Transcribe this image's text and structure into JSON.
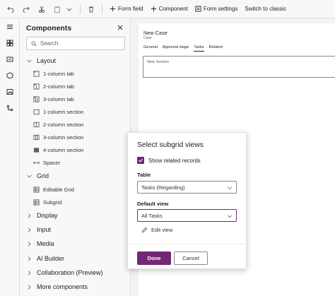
{
  "toolbar": {
    "form_field": "Form field",
    "component": "Component",
    "form_settings": "Form settings",
    "switch_classic": "Switch to classic"
  },
  "panel": {
    "title": "Components",
    "search_placeholder": "Search",
    "layout_group": "Layout",
    "layout_items": [
      "1-column tab",
      "2-column tab",
      "3-column tab",
      "1-column section",
      "2-column section",
      "3-column section",
      "4-column section",
      "Spacer"
    ],
    "grid_group": "Grid",
    "grid_items": [
      "Editable Grid",
      "Subgrid"
    ],
    "collapsed_groups": [
      "Display",
      "Input",
      "Media",
      "AI Builder",
      "Collaboration (Preview)",
      "More components"
    ]
  },
  "form": {
    "title": "New Case",
    "subtitle": "Case",
    "tabs": [
      "General",
      "Approval stage",
      "Tasks",
      "Related"
    ],
    "active_tab": "Tasks",
    "section_label": "New Section"
  },
  "dialog": {
    "title": "Select subgrid views",
    "checkbox_label": "Show related records",
    "checkbox_checked": true,
    "table_label": "Table",
    "table_value": "Tasks (Regarding)",
    "default_view_label": "Default view",
    "default_view_value": "All Tasks",
    "edit_view": "Edit view",
    "done": "Done",
    "cancel": "Cancel"
  },
  "colors": {
    "accent": "#742774"
  }
}
